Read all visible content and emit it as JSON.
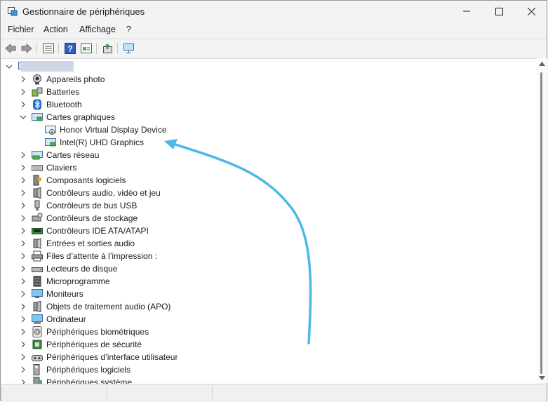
{
  "window": {
    "title": "Gestionnaire de périphériques",
    "buttons": [
      "minimize",
      "maximize",
      "close"
    ]
  },
  "menu": [
    "Fichier",
    "Action",
    "Affichage",
    "?"
  ],
  "toolbar": {
    "icons": [
      "back-icon",
      "forward-icon",
      "properties-icon",
      "help-icon",
      "view-icon",
      "update-driver-icon",
      "scan-hardware-icon"
    ]
  },
  "tree": {
    "root": "",
    "categories": [
      {
        "label": "Appareils photo",
        "icon": "camera-icon",
        "expanded": false
      },
      {
        "label": "Batteries",
        "icon": "battery-icon",
        "expanded": false
      },
      {
        "label": "Bluetooth",
        "icon": "bluetooth-icon",
        "expanded": false
      },
      {
        "label": "Cartes graphiques",
        "icon": "display-adapter-icon",
        "expanded": true,
        "children": [
          {
            "label": "Honor Virtual Display Device",
            "icon": "display-adapter-warning-icon"
          },
          {
            "label": "Intel(R) UHD Graphics",
            "icon": "display-adapter-icon"
          }
        ]
      },
      {
        "label": "Cartes réseau",
        "icon": "network-icon",
        "expanded": false
      },
      {
        "label": "Claviers",
        "icon": "keyboard-icon",
        "expanded": false
      },
      {
        "label": "Composants logiciels",
        "icon": "software-component-icon",
        "expanded": false
      },
      {
        "label": "Contrôleurs audio, vidéo et jeu",
        "icon": "speaker-icon",
        "expanded": false
      },
      {
        "label": "Contrôleurs de bus USB",
        "icon": "usb-icon",
        "expanded": false
      },
      {
        "label": "Contrôleurs de stockage",
        "icon": "storage-icon",
        "expanded": false
      },
      {
        "label": "Contrôleurs IDE ATA/ATAPI",
        "icon": "ide-icon",
        "expanded": false
      },
      {
        "label": "Entrées et sorties audio",
        "icon": "audio-io-icon",
        "expanded": false
      },
      {
        "label": "Files d’attente à l’impression :",
        "icon": "printer-icon",
        "expanded": false
      },
      {
        "label": "Lecteurs de disque",
        "icon": "disk-icon",
        "expanded": false
      },
      {
        "label": "Microprogramme",
        "icon": "chip-icon",
        "expanded": false
      },
      {
        "label": "Moniteurs",
        "icon": "monitor-icon",
        "expanded": false
      },
      {
        "label": "Objets de traitement audio (APO)",
        "icon": "speaker-icon",
        "expanded": false
      },
      {
        "label": "Ordinateur",
        "icon": "computer-icon",
        "expanded": false
      },
      {
        "label": "Périphériques biométriques",
        "icon": "fingerprint-icon",
        "expanded": false
      },
      {
        "label": "Périphériques de sécurité",
        "icon": "security-chip-icon",
        "expanded": false
      },
      {
        "label": "Périphériques d’interface utilisateur",
        "icon": "hid-icon",
        "expanded": false
      },
      {
        "label": "Périphériques logiciels",
        "icon": "software-device-icon",
        "expanded": false
      },
      {
        "label": "Périphériques système",
        "icon": "system-device-icon",
        "expanded": false
      }
    ]
  },
  "annotation": {
    "color": "#4db8e6",
    "points_to": "Intel(R) UHD Graphics"
  },
  "colors": {
    "accent": "#0078d4",
    "annotation": "#4db8e6"
  }
}
